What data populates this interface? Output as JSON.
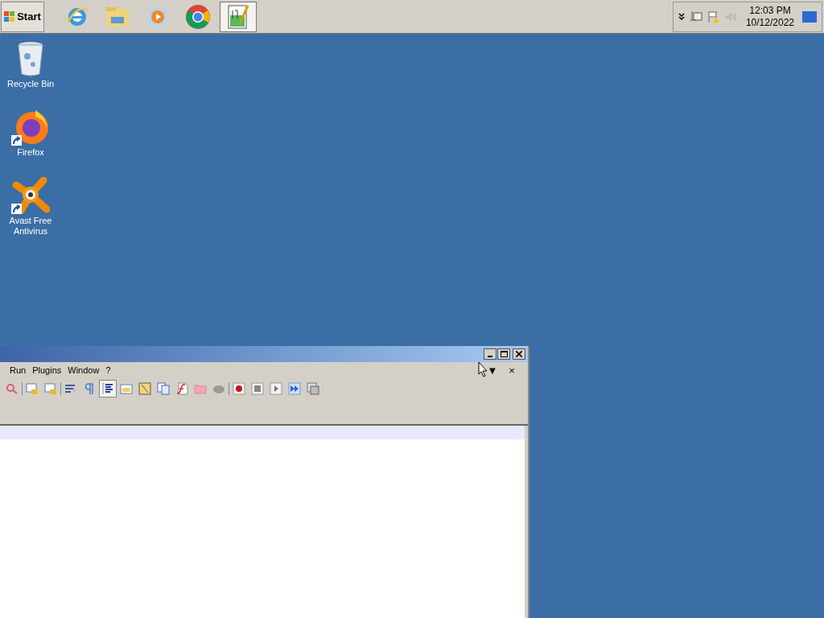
{
  "taskbar": {
    "start_label": "Start",
    "pinned": [
      {
        "kind": "ie",
        "selected": false
      },
      {
        "kind": "folder",
        "selected": false
      },
      {
        "kind": "media",
        "selected": false
      },
      {
        "kind": "chrome",
        "selected": false
      },
      {
        "kind": "notepad",
        "selected": true
      }
    ],
    "tray": {
      "time": "12:03 PM",
      "date": "10/12/2022"
    }
  },
  "desktop_icons": [
    {
      "kind": "recycle",
      "label": "Recycle Bin",
      "shortcut": false
    },
    {
      "kind": "firefox",
      "label": "Firefox",
      "shortcut": true
    },
    {
      "kind": "avast",
      "label": "Avast Free Antivirus",
      "shortcut": true
    }
  ],
  "window": {
    "menu": [
      {
        "label": "Run"
      },
      {
        "label": "Plugins"
      },
      {
        "label": "Window"
      },
      {
        "label": "?"
      }
    ],
    "menu_right": [
      "▼",
      "×"
    ],
    "toolbar": [
      {
        "kind": "find",
        "selected": false
      },
      {
        "kind": "separator"
      },
      {
        "kind": "lock-doc",
        "selected": false
      },
      {
        "kind": "lock-doc",
        "selected": false
      },
      {
        "kind": "separator"
      },
      {
        "kind": "wrap",
        "selected": false
      },
      {
        "kind": "pilcrow",
        "selected": false
      },
      {
        "kind": "indent",
        "selected": true
      },
      {
        "kind": "folder-view",
        "selected": false
      },
      {
        "kind": "map",
        "selected": false
      },
      {
        "kind": "copy",
        "selected": false
      },
      {
        "kind": "function",
        "selected": false
      },
      {
        "kind": "folder",
        "selected": false
      },
      {
        "kind": "cloud",
        "selected": false
      },
      {
        "kind": "separator"
      },
      {
        "kind": "record",
        "selected": false
      },
      {
        "kind": "stop",
        "selected": false
      },
      {
        "kind": "play",
        "selected": false
      },
      {
        "kind": "fast-forward",
        "selected": false
      },
      {
        "kind": "macro-list",
        "selected": false
      }
    ]
  }
}
